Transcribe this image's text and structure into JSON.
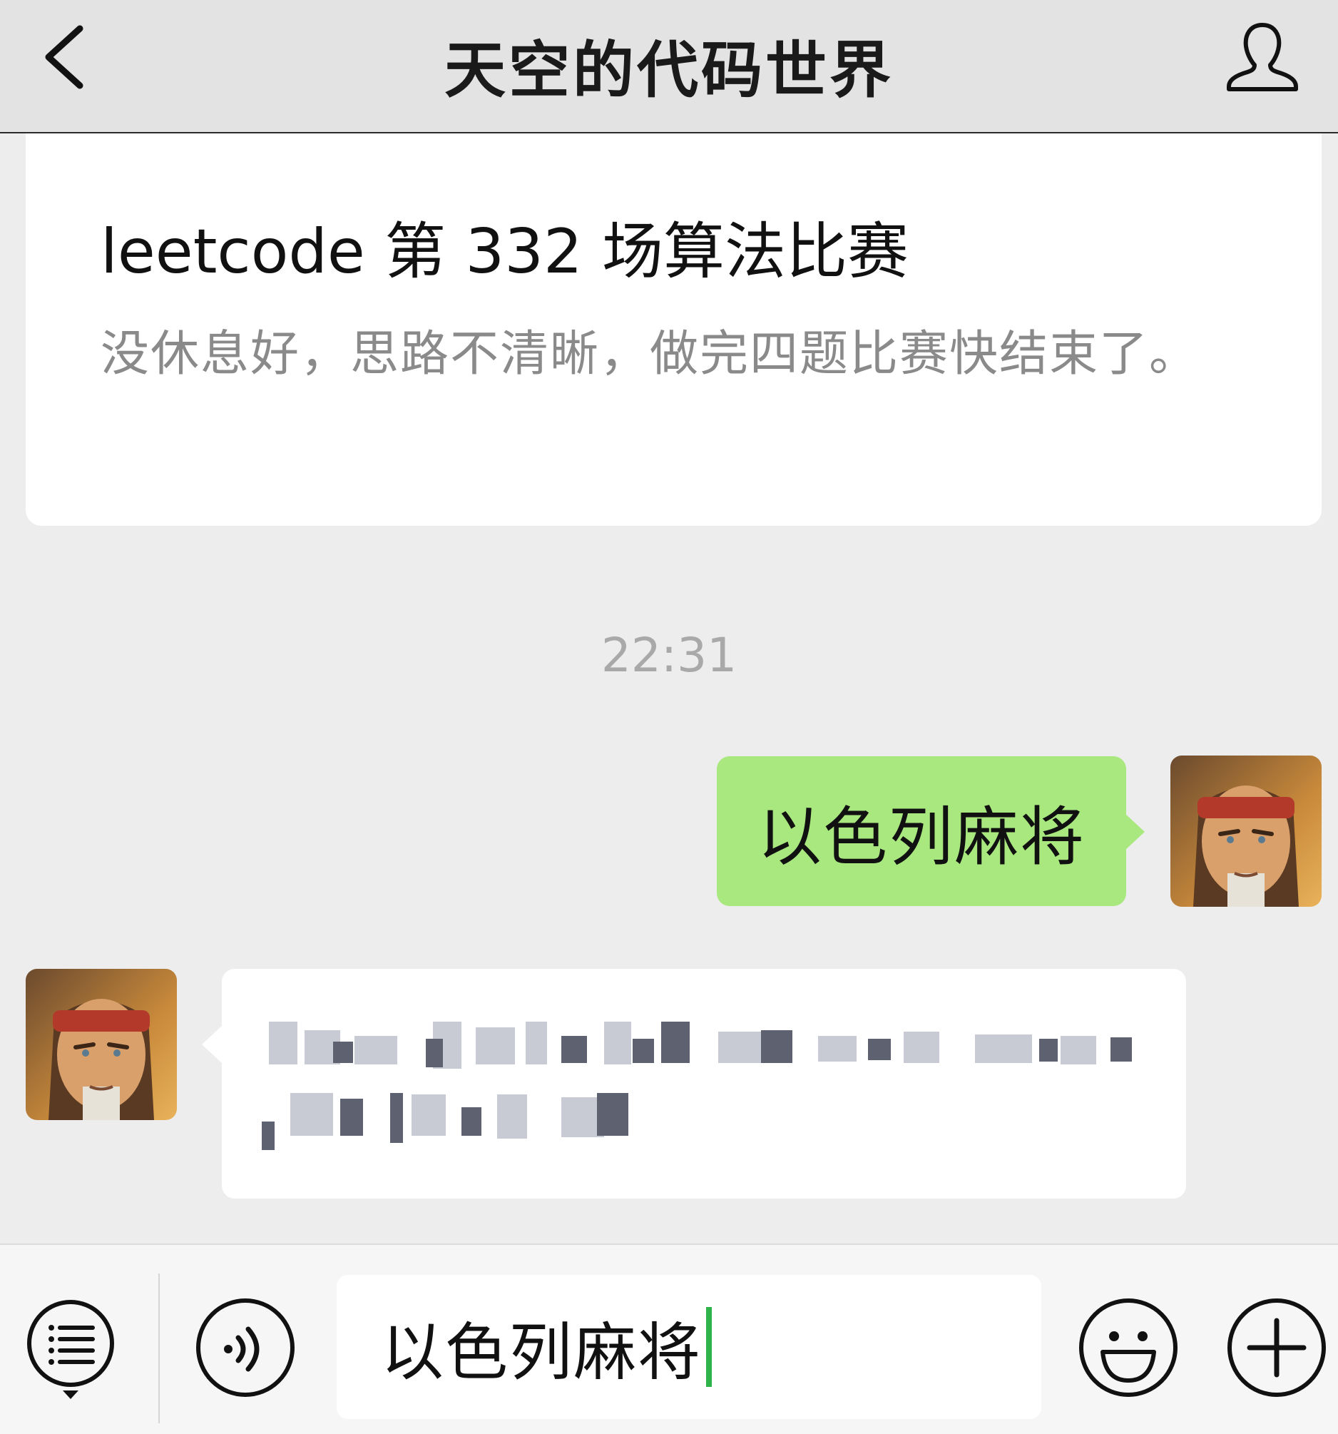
{
  "header": {
    "title": "天空的代码世界",
    "back_icon": "chevron-left-icon",
    "profile_icon": "person-icon"
  },
  "article_card": {
    "title": "leetcode 第 332 场算法比赛",
    "description": "没休息好，思路不清晰，做完四题比赛快结束了。"
  },
  "chat": {
    "timestamp": "22:31",
    "outgoing_message": "以色列麻将",
    "incoming_message_blurred": true
  },
  "input_bar": {
    "menu_icon": "list-menu-icon",
    "voice_icon": "voice-icon",
    "input_value": "以色列麻将",
    "emoji_icon": "emoji-icon",
    "plus_icon": "plus-icon"
  },
  "colors": {
    "header_bg": "#e3e3e3",
    "page_bg": "#ededed",
    "outgoing_bubble": "#a9e87e",
    "incoming_bubble": "#ffffff",
    "caret": "#2fb34a"
  }
}
